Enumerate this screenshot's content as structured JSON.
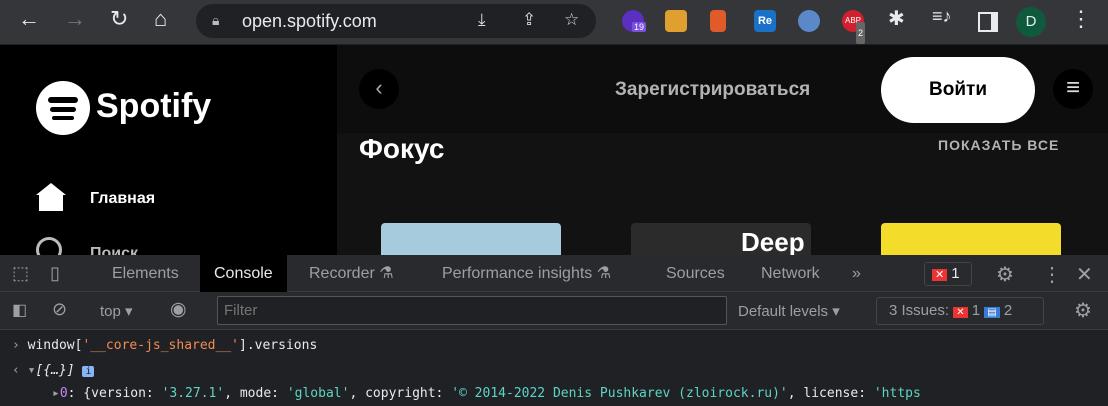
{
  "browser": {
    "url": "open.spotify.com",
    "profile_initial": "D",
    "ext_badges": [
      "19",
      "2"
    ],
    "ext_labels": [
      "Re",
      "ABP"
    ]
  },
  "spotify": {
    "logo": "Spotify",
    "nav": [
      {
        "label": "Главная"
      },
      {
        "label": "Поиск"
      }
    ],
    "signup": "Зарегистрироваться",
    "login": "Войти",
    "section_title": "Фокус",
    "show_all": "ПОКАЗАТЬ ВСЕ",
    "cards": [
      {
        "title": "",
        "color": "#a5cbdc"
      },
      {
        "title": "Deep",
        "color": "#2b2b2b"
      },
      {
        "title": "",
        "color": "#f3dd2a"
      }
    ]
  },
  "devtools": {
    "tabs": [
      "Elements",
      "Console",
      "Recorder",
      "Performance insights",
      "Sources",
      "Network"
    ],
    "more": "»",
    "error_count": "1",
    "context": "top",
    "filter_placeholder": "Filter",
    "levels": "Default levels",
    "issues_label": "3 Issues:",
    "issues_errors": "1",
    "issues_info": "2"
  },
  "console": {
    "input": {
      "prefix": "window[",
      "str": "'__core-js_shared__'",
      "suffix": "].versions"
    },
    "result": "[{…}]",
    "entry": {
      "index": "0",
      "text_a": ": {version: ",
      "version": "'3.27.1'",
      "text_b": ", mode: ",
      "mode": "'global'",
      "text_c": ", copyright: ",
      "copyright": "'© 2014-2022 Denis Pushkarev (zloirock.ru)'",
      "text_d": ", license: ",
      "license": "'https"
    }
  }
}
